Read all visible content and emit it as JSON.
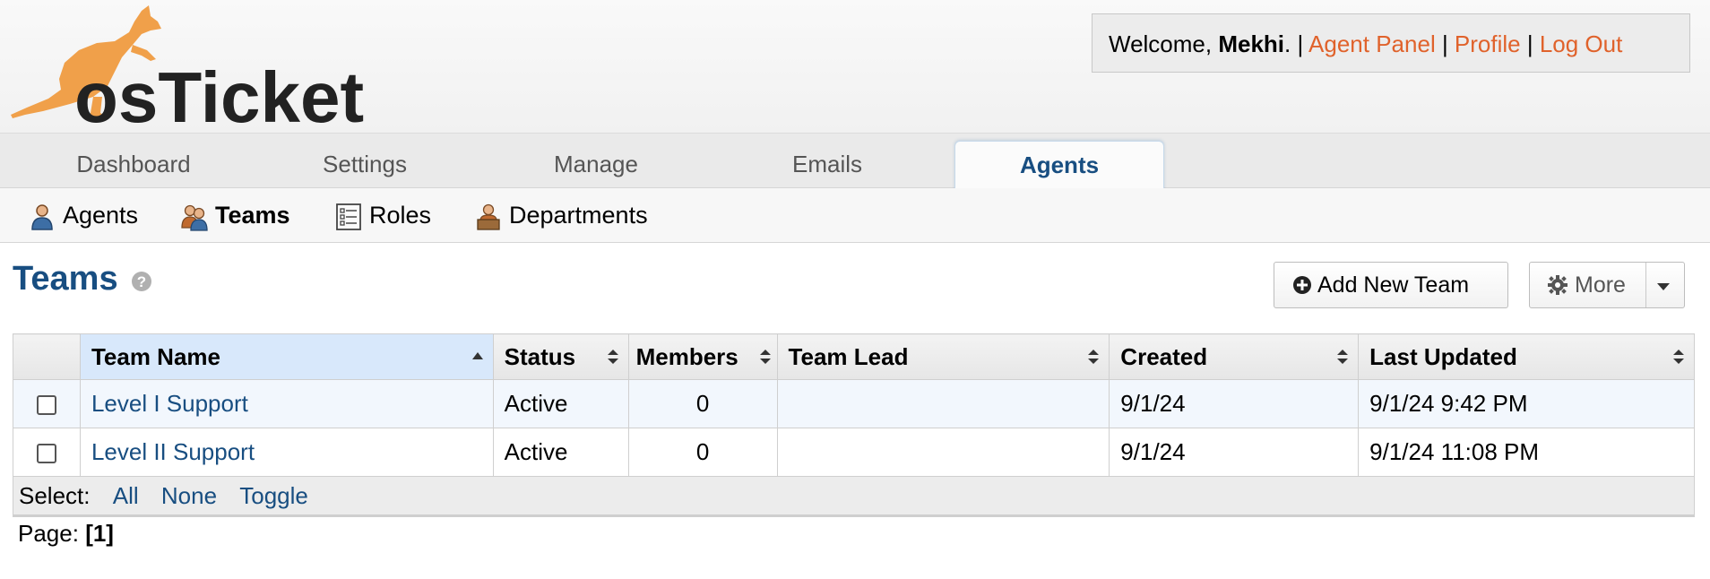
{
  "header": {
    "logo_text": "osTicket",
    "welcome_prefix": "Welcome, ",
    "user_name": "Mekhi",
    "welcome_suffix": ".",
    "separator": " | ",
    "links": [
      "Agent Panel",
      "Profile",
      "Log Out"
    ],
    "link_color": "#e0622b"
  },
  "nav": {
    "tabs": [
      "Dashboard",
      "Settings",
      "Manage",
      "Emails",
      "Agents"
    ],
    "active": "Agents"
  },
  "subnav": {
    "items": [
      {
        "label": "Agents",
        "icon": "agent-icon"
      },
      {
        "label": "Teams",
        "icon": "teams-icon"
      },
      {
        "label": "Roles",
        "icon": "roles-icon"
      },
      {
        "label": "Departments",
        "icon": "departments-icon"
      }
    ],
    "active": "Teams"
  },
  "page": {
    "title": "Teams",
    "add_button": "Add New Team",
    "more_button": "More"
  },
  "table": {
    "columns": [
      "Team Name",
      "Status",
      "Members",
      "Team Lead",
      "Created",
      "Last Updated"
    ],
    "rows": [
      {
        "name": "Level I Support",
        "status": "Active",
        "members": "0",
        "lead": "",
        "created": "9/1/24",
        "updated": "9/1/24 9:42 PM"
      },
      {
        "name": "Level II Support",
        "status": "Active",
        "members": "0",
        "lead": "",
        "created": "9/1/24",
        "updated": "9/1/24 11:08 PM"
      }
    ],
    "select_label": "Select:",
    "select_options": [
      "All",
      "None",
      "Toggle"
    ]
  },
  "pager": {
    "label": "Page:",
    "current": "[1]"
  },
  "colors": {
    "brand_blue": "#184e81",
    "logo_orange": "#f0a04a"
  }
}
